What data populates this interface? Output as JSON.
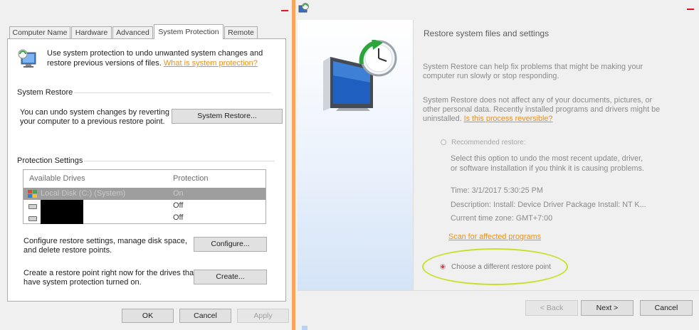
{
  "left_window": {
    "tabs": [
      {
        "label": "Computer Name",
        "active": false
      },
      {
        "label": "Hardware",
        "active": false
      },
      {
        "label": "Advanced",
        "active": false
      },
      {
        "label": "System Protection",
        "active": true
      },
      {
        "label": "Remote",
        "active": false
      }
    ],
    "intro": {
      "text_line1": "Use system protection to undo unwanted system changes and",
      "text_line2": "restore previous versions of files.",
      "link": "What is system protection?"
    },
    "system_restore": {
      "heading": "System Restore",
      "desc_line1": "You can undo system changes by reverting",
      "desc_line2": "your computer to a previous restore point.",
      "button": "System Restore..."
    },
    "protection_settings": {
      "heading": "Protection Settings",
      "columns": [
        "Available Drives",
        "Protection"
      ],
      "drives": [
        {
          "name": "Local Disk (C:) (System)",
          "protection": "On",
          "selected": true
        },
        {
          "name": "",
          "protection": "Off",
          "selected": false
        },
        {
          "name": "",
          "protection": "Off",
          "selected": false
        }
      ]
    },
    "configure": {
      "desc_line1": "Configure restore settings, manage disk space,",
      "desc_line2": "and delete restore points.",
      "button": "Configure..."
    },
    "create": {
      "desc_line1": "Create a restore point right now for the drives that",
      "desc_line2": "have system protection turned on.",
      "button": "Create..."
    },
    "footer": {
      "ok": "OK",
      "cancel": "Cancel",
      "apply": "Apply"
    }
  },
  "right_window": {
    "heading": "Restore system files and settings",
    "para1_line1": "System Restore can help fix problems that might be making your",
    "para1_line2": "computer run slowly or stop responding.",
    "para2_line1": "System Restore does not affect any of your documents, pictures, or",
    "para2_line2": "other personal data. Recently installed programs and drivers might be",
    "para2_line3": "uninstalled.",
    "para2_link": "Is this process reversible?",
    "recommended": {
      "label": "Recommended restore:",
      "desc_line1": "Select this option to undo the most recent update, driver,",
      "desc_line2": "or software installation if you think it is causing problems.",
      "time": "Time: 3/1/2017 5:30:25 PM",
      "description": "Description: Install: Device Driver Package Install: NT K...",
      "timezone": "Current time zone: GMT+7:00",
      "scan_link": "Scan for affected programs"
    },
    "different": {
      "label": "Choose a different restore point",
      "selected": true
    },
    "footer": {
      "back": "< Back",
      "next": "Next >",
      "cancel": "Cancel"
    }
  },
  "colors": {
    "accent_link": "#e8901a",
    "window_border": "#f5a65b",
    "annotation": "#c9e02a"
  }
}
